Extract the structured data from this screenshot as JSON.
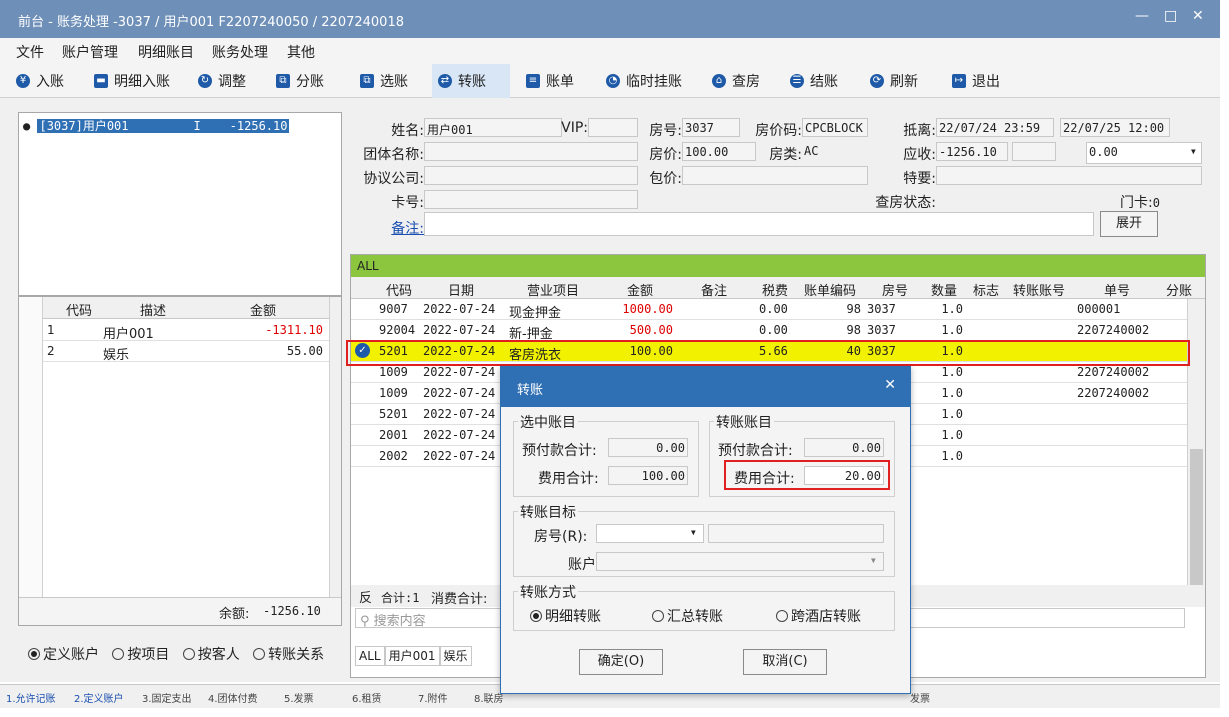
{
  "window": {
    "title": "前台 - 账务处理 -3037 / 用户001 F2207240050 / 2207240018",
    "controls": [
      "—",
      "□",
      "✕"
    ]
  },
  "menu": [
    "文件",
    "账户管理",
    "明细账目",
    "账务处理",
    "其他"
  ],
  "toolbar": [
    {
      "label": "入账",
      "icon": "¥"
    },
    {
      "label": "明细入账",
      "icon": "▬"
    },
    {
      "label": "调整",
      "icon": "↻"
    },
    {
      "label": "分账",
      "icon": "⧉"
    },
    {
      "label": "选账",
      "icon": "⧉"
    },
    {
      "label": "转账",
      "icon": "⇄"
    },
    {
      "label": "账单",
      "icon": "≡"
    },
    {
      "label": "临时挂账",
      "icon": "◔"
    },
    {
      "label": "查房",
      "icon": "⌂"
    },
    {
      "label": "结账",
      "icon": "☰"
    },
    {
      "label": "刷新",
      "icon": "⟳"
    },
    {
      "label": "退出",
      "icon": "↦"
    }
  ],
  "left": {
    "tree_item": {
      "room": "[3037]用户001",
      "flag": "I",
      "amount": "-1256.10"
    },
    "accounts_headers": [
      "代码",
      "描述",
      "金额"
    ],
    "accounts": [
      {
        "code": "1",
        "desc": "用户001",
        "amount": "-1311.10"
      },
      {
        "code": "2",
        "desc": "娱乐",
        "amount": "55.00"
      }
    ],
    "balance_label": "余额:",
    "balance": "-1256.10",
    "view_options": [
      "定义账户",
      "按项目",
      "按客人",
      "转账关系"
    ],
    "view_selected": 0
  },
  "guest": {
    "name_label": "姓名:",
    "name": "用户001",
    "vip_label": "VIP:",
    "vip": "",
    "room_label": "房号:",
    "room": "3037",
    "rate_code_label": "房价码:",
    "rate_code": "CPCBLOCK",
    "arrive_label": "抵离:",
    "arrive": "22/07/24 23:59",
    "depart": "22/07/25 12:00",
    "group_label": "团体名称:",
    "rate_label": "房价:",
    "rate": "100.00",
    "room_type_label": "房类:",
    "room_type": "AC",
    "receivable_label": "应收:",
    "receivable": "-1256.10",
    "dropdown_value": "0.00",
    "company_label": "协议公司:",
    "package_label": "包价:",
    "special_label": "特要:",
    "card_label": "卡号:",
    "inspect_label": "查房状态:",
    "door_card_label": "门卡:",
    "door_card": "0",
    "remark_label": "备注:",
    "expand_button": "展开"
  },
  "grid": {
    "group_label": "ALL",
    "headers": [
      "代码",
      "日期",
      "营业项目",
      "金额",
      "备注",
      "税费",
      "账单编码",
      "房号",
      "数量",
      "标志",
      "转账账号",
      "单号",
      "分账"
    ],
    "rows": [
      {
        "code": "9007",
        "date": "2022-07-24",
        "item": "现金押金",
        "amount": "1000.00",
        "tax": "0.00",
        "bill": "98",
        "room": "3037",
        "qty": "1.0",
        "no": "000001",
        "red": true
      },
      {
        "code": "92004",
        "date": "2022-07-24",
        "item": "新-押金",
        "amount": "500.00",
        "tax": "0.00",
        "bill": "98",
        "room": "3037",
        "qty": "1.0",
        "no": "2207240002",
        "red": true
      },
      {
        "code": "5201",
        "date": "2022-07-24",
        "item": "客房洗衣",
        "amount": "100.00",
        "tax": "5.66",
        "bill": "40",
        "room": "3037",
        "qty": "1.0",
        "no": "",
        "selected": true
      },
      {
        "code": "1009",
        "date": "2022-07-24",
        "item": "",
        "amount": "",
        "tax": "",
        "bill": "",
        "room": "",
        "qty": "1.0",
        "no": "2207240002"
      },
      {
        "code": "1009",
        "date": "2022-07-24",
        "item": "",
        "amount": "",
        "tax": "",
        "bill": "",
        "room": "",
        "qty": "1.0",
        "no": "2207240002"
      },
      {
        "code": "5201",
        "date": "2022-07-24",
        "item": "",
        "amount": "",
        "tax": "",
        "bill": "",
        "room": "",
        "qty": "1.0",
        "no": ""
      },
      {
        "code": "2001",
        "date": "2022-07-24",
        "item": "",
        "amount": "",
        "tax": "",
        "bill": "",
        "room": "",
        "qty": "1.0",
        "no": ""
      },
      {
        "code": "2002",
        "date": "2022-07-24",
        "item": "",
        "amount": "",
        "tax": "",
        "bill": "",
        "room": "",
        "qty": "1.0",
        "no": ""
      }
    ],
    "footer_reverse": "反",
    "footer_count": "合计:1",
    "footer_consume": "消费合计:",
    "search_placeholder": "搜索内容",
    "bottom_tabs": [
      "ALL",
      "用户001",
      "娱乐"
    ]
  },
  "dialog": {
    "title": "转账",
    "selected_group": "选中账目",
    "transfer_group": "转账账目",
    "prepay_label": "预付款合计:",
    "fee_label": "费用合计:",
    "sel_prepay": "0.00",
    "sel_fee": "100.00",
    "tr_prepay": "0.00",
    "tr_fee": "20.00",
    "target_group": "转账目标",
    "room_label": "房号(R):",
    "account_label": "账户:",
    "method_group": "转账方式",
    "methods": [
      "明细转账",
      "汇总转账",
      "跨酒店转账"
    ],
    "method_selected": 0,
    "ok": "确定(O)",
    "cancel": "取消(C)"
  },
  "status_tabs": [
    "1.允许记账",
    "2.定义账户",
    "3.固定支出",
    "4.团体付费",
    "5.发票",
    "6.租赁",
    "7.附件",
    "8.联房",
    "发票"
  ],
  "colors": {
    "title": "#6d8fb8",
    "dialog_title": "#2f6fb4",
    "highlight_row": "#f2f200",
    "group_bar": "#8cc63f",
    "red_box": "#e02020",
    "amount_red": "#e00000"
  }
}
